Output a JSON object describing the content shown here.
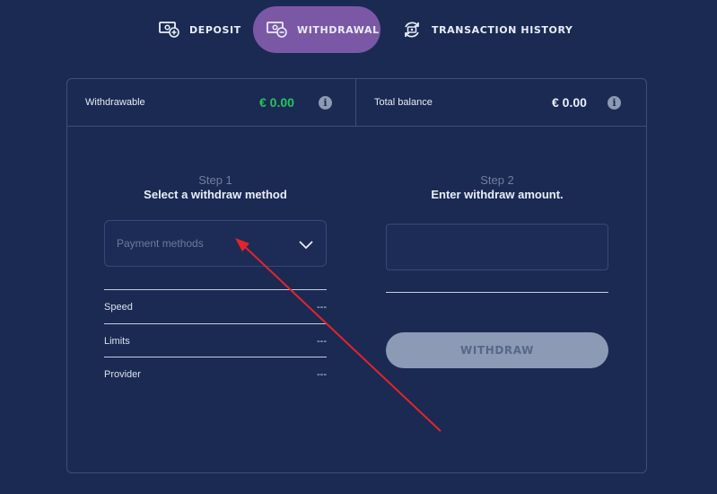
{
  "tabs": {
    "deposit": "DEPOSIT",
    "withdrawal": "WITHDRAWAL",
    "history": "TRANSACTION HISTORY",
    "active": "withdrawal"
  },
  "balances": {
    "withdrawable_label": "Withdrawable",
    "withdrawable_value": "€ 0.00",
    "total_label": "Total balance",
    "total_value": "€ 0.00"
  },
  "step1": {
    "number": "Step 1",
    "title": "Select a withdraw method",
    "select_placeholder": "Payment methods",
    "rows": [
      {
        "label": "Speed",
        "value": "---"
      },
      {
        "label": "Limits",
        "value": "---"
      },
      {
        "label": "Provider",
        "value": "---"
      }
    ]
  },
  "step2": {
    "number": "Step 2",
    "title": "Enter withdraw amount.",
    "amount_value": "",
    "withdraw_button": "WITHDRAW"
  },
  "colors": {
    "background": "#1b2a52",
    "active_tab": "#7b58a6",
    "positive_amount": "#22c55e",
    "annotation_arrow": "#e3242b",
    "disabled_button": "#8d9ab5"
  },
  "icons": {
    "deposit": "cash-plus-icon",
    "withdrawal": "cash-minus-icon",
    "history": "refresh-cash-icon",
    "info": "info-icon",
    "select": "chevron-down-icon"
  }
}
